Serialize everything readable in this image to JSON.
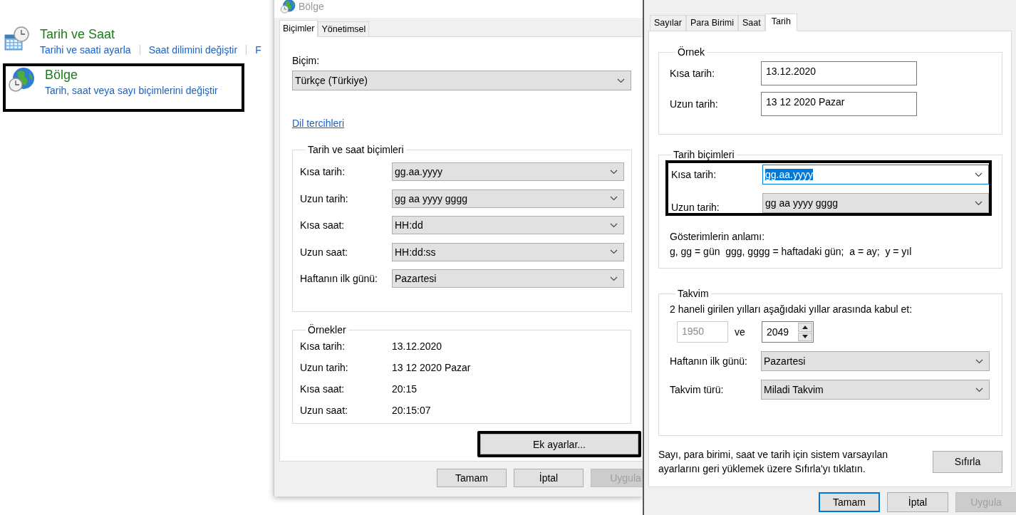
{
  "control_panel": {
    "categories": [
      {
        "title": "Tarih ve Saat",
        "highlighted": false,
        "links": [
          "Tarihi ve saati ayarla",
          "Saat dilimini değiştir",
          "F"
        ]
      },
      {
        "title": "Bölge",
        "highlighted": true,
        "links": [
          "Tarih, saat veya sayı biçimlerini değiştir"
        ]
      }
    ]
  },
  "region_dialog": {
    "title": "Bölge",
    "tabs": [
      {
        "label": "Biçimler",
        "selected": true
      },
      {
        "label": "Yönetimsel",
        "selected": false
      }
    ],
    "format_label": "Biçim:",
    "format_value": "Türkçe (Türkiye)",
    "language_link": "Dil tercihleri",
    "formats_group": {
      "title": "Tarih ve saat biçimleri",
      "rows": [
        {
          "label": "Kısa tarih:",
          "value": "gg.aa.yyyy"
        },
        {
          "label": "Uzun tarih:",
          "value": "gg aa yyyy gggg"
        },
        {
          "label": "Kısa saat:",
          "value": "HH:dd"
        },
        {
          "label": "Uzun saat:",
          "value": "HH:dd:ss"
        },
        {
          "label": "Haftanın ilk günü:",
          "value": "Pazartesi"
        }
      ]
    },
    "examples_group": {
      "title": "Örnekler",
      "rows": [
        {
          "label": "Kısa tarih:",
          "value": "13.12.2020"
        },
        {
          "label": "Uzun tarih:",
          "value": "13 12 2020 Pazar"
        },
        {
          "label": "Kısa saat:",
          "value": "20:15"
        },
        {
          "label": "Uzun saat:",
          "value": "20:15:07"
        }
      ]
    },
    "additional_button": {
      "label": "Ek ayarlar...",
      "highlighted": true
    },
    "buttons": [
      {
        "label": "Tamam",
        "disabled": false,
        "default": false
      },
      {
        "label": "İptal",
        "disabled": false,
        "default": false
      },
      {
        "label": "Uygula",
        "disabled": true,
        "default": false
      }
    ]
  },
  "customize_dialog": {
    "tabs": [
      {
        "label": "Sayılar",
        "selected": false
      },
      {
        "label": "Para Birimi",
        "selected": false
      },
      {
        "label": "Saat",
        "selected": false
      },
      {
        "label": "Tarih",
        "selected": true
      }
    ],
    "example_group": {
      "title": "Örnek",
      "rows": [
        {
          "label": "Kısa tarih:",
          "value": "13.12.2020"
        },
        {
          "label": "Uzun tarih:",
          "value": "13 12 2020 Pazar"
        }
      ]
    },
    "date_formats_group": {
      "title": "Tarih biçimleri",
      "highlighted": true,
      "rows": [
        {
          "label": "Kısa tarih:",
          "value": "gg.aa.yyyy",
          "focused": true
        },
        {
          "label": "Uzun tarih:",
          "value": "gg aa yyyy gggg",
          "focused": false
        }
      ],
      "legend_title": "Gösterimlerin anlamı:",
      "legend_text": "g, gg = gün  ggg, gggg = haftadaki gün;  a = ay;  y = yıl"
    },
    "calendar_group": {
      "title": "Takvim",
      "range_text": "2 haneli girilen yılları aşağıdaki yıllar arasında kabul et:",
      "year_from": {
        "value": "1950",
        "disabled": true
      },
      "range_joiner": "ve",
      "year_to": {
        "value": "2049",
        "disabled": false
      },
      "rows": [
        {
          "label": "Haftanın ilk günü:",
          "value": "Pazartesi"
        },
        {
          "label": "Takvim türü:",
          "value": "Miladi Takvim"
        }
      ]
    },
    "reset_text": "Sayı, para birimi, saat ve tarih için sistem varsayılan ayarlarını geri yüklemek üzere Sıfırla'yı tıklatın.",
    "reset_button": "Sıfırla",
    "buttons": [
      {
        "label": "Tamam",
        "disabled": false,
        "default": true
      },
      {
        "label": "İptal",
        "disabled": false,
        "default": false
      },
      {
        "label": "Uygula",
        "disabled": true,
        "default": false
      }
    ]
  }
}
